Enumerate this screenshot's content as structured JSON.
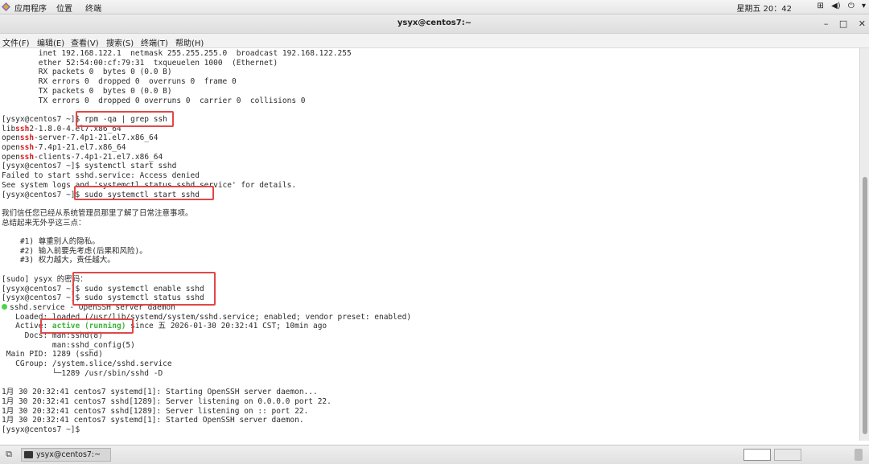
{
  "topbar": {
    "applications": "应用程序",
    "places": "位置",
    "terminal": "终端",
    "clock": "星期五 20：42",
    "network_icon": "network-icon",
    "volume_icon": "volume-icon",
    "power_icon": "power-icon",
    "dropdown": "▾"
  },
  "window": {
    "title": "ysyx@centos7:~",
    "minimize": "–",
    "maximize": "□",
    "close": "✕"
  },
  "menu": {
    "file": "文件(F)",
    "edit": "编辑(E)",
    "view": "查看(V)",
    "search": "搜索(S)",
    "terminal": "终端(T)",
    "help": "帮助(H)"
  },
  "terminal_lines": [
    {
      "t": "        inet 192.168.122.1  netmask 255.255.255.0  broadcast 192.168.122.255"
    },
    {
      "t": "        ether 52:54:00:cf:79:31  txqueuelen 1000  (Ethernet)"
    },
    {
      "t": "        RX packets 0  bytes 0 (0.0 B)"
    },
    {
      "t": "        RX errors 0  dropped 0  overruns 0  frame 0"
    },
    {
      "t": "        TX packets 0  bytes 0 (0.0 B)"
    },
    {
      "t": "        TX errors 0  dropped 0 overruns 0  carrier 0  collisions 0"
    },
    {
      "t": ""
    },
    {
      "t": "[ysyx@centos7 ~]$ rpm -qa | grep ssh"
    },
    {
      "pre": "lib",
      "hl": "ssh",
      "post": "2-1.8.0-4.el7.x86_64"
    },
    {
      "pre": "open",
      "hl": "ssh",
      "post": "-server-7.4p1-21.el7.x86_64"
    },
    {
      "pre": "open",
      "hl": "ssh",
      "post": "-7.4p1-21.el7.x86_64"
    },
    {
      "pre": "open",
      "hl": "ssh",
      "post": "-clients-7.4p1-21.el7.x86_64"
    },
    {
      "t": "[ysyx@centos7 ~]$ systemctl start sshd"
    },
    {
      "t": "Failed to start sshd.service: Access denied"
    },
    {
      "t": "See system logs and 'systemctl status sshd.service' for details."
    },
    {
      "t": "[ysyx@centos7 ~]$ sudo systemctl start sshd"
    },
    {
      "t": ""
    },
    {
      "t": "我们信任您已经从系统管理员那里了解了日常注意事项。"
    },
    {
      "t": "总结起来无外乎这三点："
    },
    {
      "t": ""
    },
    {
      "t": "    #1) 尊重别人的隐私。"
    },
    {
      "t": "    #2) 输入前要先考虑(后果和风险)。"
    },
    {
      "t": "    #3) 权力越大，责任越大。"
    },
    {
      "t": ""
    },
    {
      "t": "[sudo] ysyx 的密码："
    },
    {
      "t": "[ysyx@centos7 ~]$ sudo systemctl enable sshd"
    },
    {
      "t": "[ysyx@centos7 ~]$ sudo systemctl status sshd"
    },
    {
      "dot": true,
      "t": "sshd.service - OpenSSH server daemon"
    },
    {
      "t": "   Loaded: loaded (/usr/lib/systemd/system/sshd.service; enabled; vendor preset: enabled)"
    },
    {
      "pre": "   Active: ",
      "green": "active (running)",
      "post": " since 五 2026-01-30 20:32:41 CST; 10min ago"
    },
    {
      "t": "     Docs: man:sshd(8)"
    },
    {
      "t": "           man:sshd_config(5)"
    },
    {
      "t": " Main PID: 1289 (sshd)"
    },
    {
      "t": "   CGroup: /system.slice/sshd.service"
    },
    {
      "t": "           └─1289 /usr/sbin/sshd -D"
    },
    {
      "t": ""
    },
    {
      "t": "1月 30 20:32:41 centos7 systemd[1]: Starting OpenSSH server daemon..."
    },
    {
      "t": "1月 30 20:32:41 centos7 sshd[1289]: Server listening on 0.0.0.0 port 22."
    },
    {
      "t": "1月 30 20:32:41 centos7 sshd[1289]: Server listening on :: port 22."
    },
    {
      "t": "1月 30 20:32:41 centos7 systemd[1]: Started OpenSSH server daemon."
    },
    {
      "t": "[ysyx@centos7 ~]$ "
    }
  ],
  "taskbar": {
    "task_label": "ysyx@centos7:~"
  }
}
